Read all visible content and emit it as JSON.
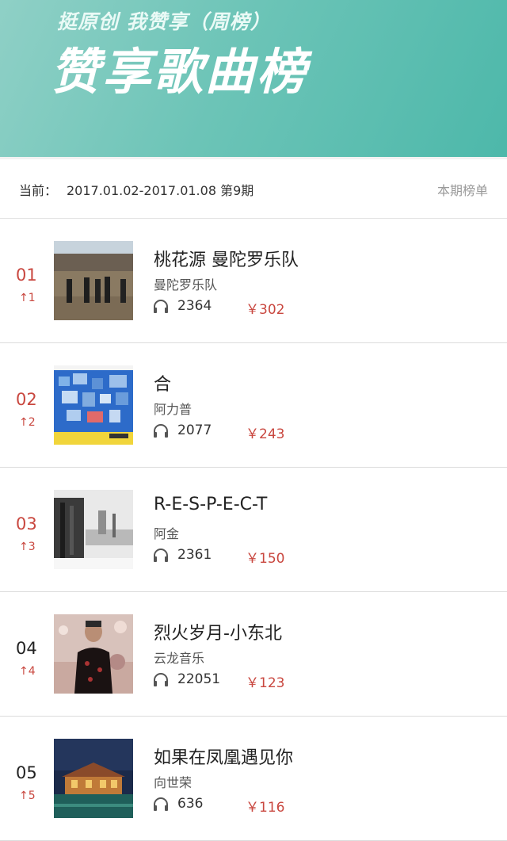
{
  "header": {
    "subtitle": "挺原创 我赞享（周榜）",
    "title": "赞享歌曲榜"
  },
  "period": {
    "label": "当前：",
    "range": "2017.01.02-2017.01.08 第9期",
    "current": "本期榜单"
  },
  "songs": [
    {
      "rank": "01",
      "trend": "↑1",
      "title": "桃花源 曼陀罗乐队",
      "artist": "曼陀罗乐队",
      "plays": "2364",
      "price": "￥302"
    },
    {
      "rank": "02",
      "trend": "↑2",
      "title": "合",
      "artist": "阿力普",
      "plays": "2077",
      "price": "￥243"
    },
    {
      "rank": "03",
      "trend": "↑3",
      "title": "R-E-S-P-E-C-T",
      "artist": "阿金",
      "plays": "2361",
      "price": "￥150"
    },
    {
      "rank": "04",
      "trend": "↑4",
      "title": "烈火岁月-小东北",
      "artist": "云龙音乐",
      "plays": "22051",
      "price": "￥123"
    },
    {
      "rank": "05",
      "trend": "↑5",
      "title": "如果在凤凰遇见你",
      "artist": "向世荣",
      "plays": "636",
      "price": "￥116"
    }
  ],
  "colors": {
    "accent_red": "#c9473f",
    "banner_teal": "#5bbfb1"
  },
  "icons": {
    "plays": "headphones-icon"
  }
}
